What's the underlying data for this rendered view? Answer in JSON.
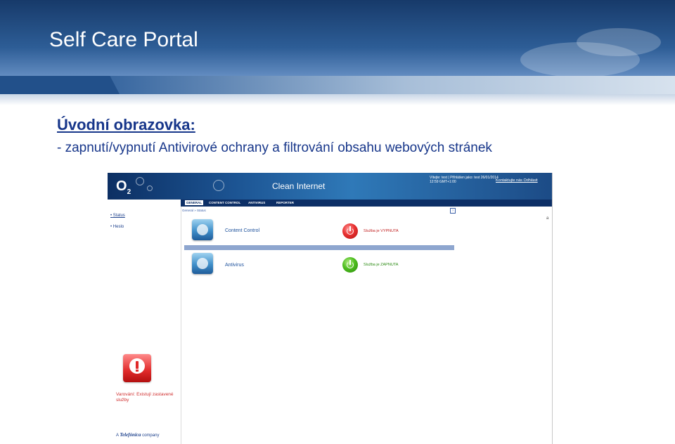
{
  "slide": {
    "title": "Self Care Portal",
    "heading": "Úvodní obrazovka:",
    "bullet": "- zapnutí/vypnutí Antivirové ochrany a filtrování obsahu webových stránek"
  },
  "portal": {
    "logo": "O2",
    "logo_sub": "2",
    "app_title": "Clean Internet",
    "user_info": "Vítejte: test | Přihlášen jako: test 26/01/2014 12:59 GMT+1:00",
    "contact_link": "Kontaktujte nás  Odhlásit",
    "nav_tabs": [
      "GENERAL",
      "CONTENT CONTROL",
      "ANTIVIRUS",
      "REPORTER"
    ],
    "breadcrumb": "General  »  Status",
    "help_icon": "?",
    "sidebar": [
      "Status",
      "Heslo"
    ],
    "services": [
      {
        "label": "Content Control",
        "status": "Služba je VYPNUTA",
        "state": "off"
      },
      {
        "label": "Antivirus",
        "status": "Služba je ZAPNUTA",
        "state": "on"
      }
    ],
    "warning_text": "Varování: Existují zastavené služby",
    "footer_prefix": "A",
    "footer_brand": "Telefónica",
    "footer_suffix": "company",
    "colors": {
      "header_dark": "#0c2f63",
      "accent_blue": "#17368a",
      "off_red": "#e83030",
      "on_green": "#4dbd1e"
    }
  }
}
